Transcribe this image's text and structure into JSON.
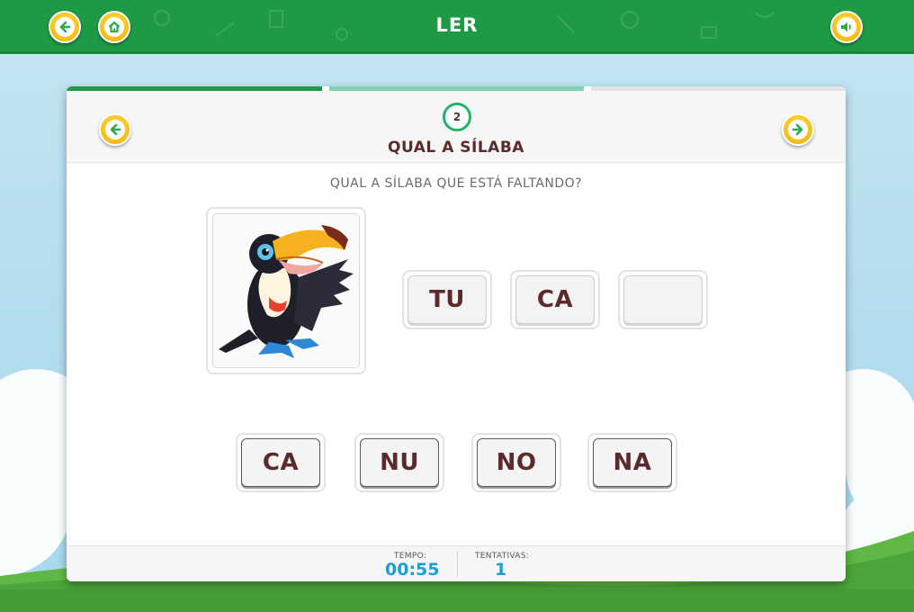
{
  "header": {
    "title": "LER",
    "back_icon": "arrow-left-icon",
    "home_icon": "home-icon",
    "sound_icon": "speaker-icon"
  },
  "colors": {
    "header_green": "#1e9a45",
    "button_yellow": "#f7c21a",
    "arrow_green": "#2fa84f",
    "title_brown": "#5a2b2a",
    "stat_blue": "#1c9fd1",
    "progress_done": "#1e9a45",
    "progress_current": "#7fd3b3",
    "progress_pending": "#e3e3e3"
  },
  "progress": {
    "segments": [
      "done",
      "current",
      "pending"
    ]
  },
  "activity": {
    "step_number": "2",
    "title": "QUAL A SÍLABA",
    "question": "QUAL A SÍLABA QUE ESTÁ FALTANDO?",
    "image_subject": "toucan-illustration",
    "word_slots": [
      "TU",
      "CA",
      ""
    ],
    "options": [
      "CA",
      "NU",
      "NO",
      "NA"
    ],
    "prev_icon": "arrow-left-icon",
    "next_icon": "arrow-right-icon"
  },
  "footer": {
    "time_label": "TEMPO:",
    "time_value": "00:55",
    "attempts_label": "TENTATIVAS:",
    "attempts_value": "1"
  }
}
